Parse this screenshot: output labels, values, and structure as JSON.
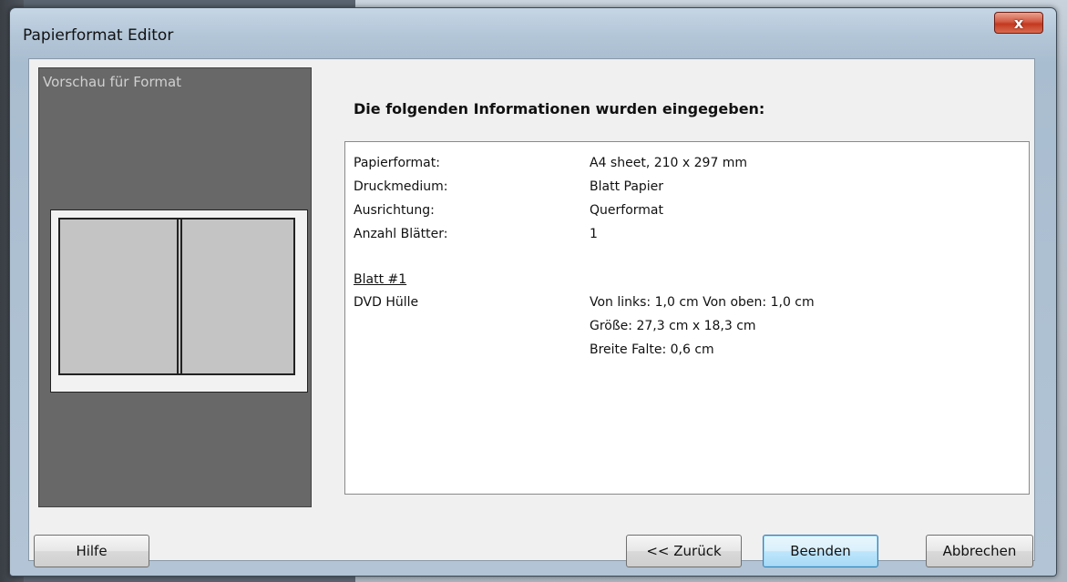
{
  "window": {
    "title": "Papierformat Editor",
    "close_glyph": "x"
  },
  "preview": {
    "label": "Vorschau für Format"
  },
  "heading": "Die folgenden Informationen wurden eingegeben:",
  "info": {
    "rows": [
      {
        "label": "Papierformat:",
        "value": "A4 sheet, 210 x 297 mm"
      },
      {
        "label": "Druckmedium:",
        "value": "Blatt Papier"
      },
      {
        "label": "Ausrichtung:",
        "value": "Querformat"
      },
      {
        "label": "Anzahl Blätter:",
        "value": "1"
      }
    ],
    "sheet_title": "Blatt #1",
    "sheet_item": "DVD Hülle",
    "sheet_details": [
      "Von links: 1,0 cm Von oben: 1,0 cm",
      "Größe: 27,3 cm x 18,3 cm",
      "Breite Falte: 0,6 cm"
    ]
  },
  "buttons": {
    "help": "Hilfe",
    "back": "<< Zurück",
    "finish": "Beenden",
    "cancel": "Abbrechen"
  }
}
